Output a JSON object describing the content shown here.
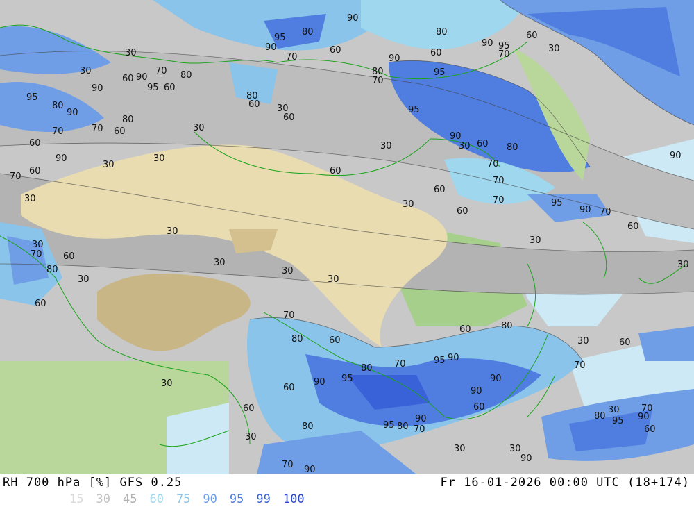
{
  "footer": {
    "title": "RH 700 hPa [%] GFS 0.25",
    "timestamp": "Fr 16-01-2026 00:00 UTC (18+174)"
  },
  "legend": [
    {
      "label": "15",
      "color": "#d9d9d9"
    },
    {
      "label": "30",
      "color": "#c3c3c3"
    },
    {
      "label": "45",
      "color": "#b0b0b0"
    },
    {
      "label": "60",
      "color": "#9fd7ee"
    },
    {
      "label": "75",
      "color": "#8ac4ea"
    },
    {
      "label": "90",
      "color": "#6f9ee6"
    },
    {
      "label": "95",
      "color": "#4f7ee0"
    },
    {
      "label": "99",
      "color": "#3a62d8"
    },
    {
      "label": "100",
      "color": "#2d46d0"
    }
  ],
  "contour_labels": [
    "90",
    "80",
    "95",
    "90",
    "80",
    "60",
    "70",
    "60",
    "90",
    "80",
    "95",
    "70",
    "90",
    "95",
    "70",
    "60",
    "30",
    "30",
    "30",
    "60",
    "90",
    "70",
    "80",
    "95",
    "60",
    "80",
    "60",
    "90",
    "95",
    "80",
    "90",
    "80",
    "70",
    "60",
    "30",
    "70",
    "60",
    "60",
    "30",
    "95",
    "90",
    "30",
    "30",
    "90",
    "30",
    "60",
    "80",
    "70",
    "60",
    "70",
    "60",
    "70",
    "60",
    "30",
    "95",
    "90",
    "70",
    "60",
    "30",
    "30",
    "30",
    "70",
    "60",
    "30",
    "30",
    "30",
    "90",
    "30",
    "60",
    "30",
    "30",
    "70",
    "80",
    "60",
    "80",
    "70",
    "95",
    "90",
    "80",
    "70",
    "30",
    "60",
    "90",
    "95",
    "90",
    "95",
    "60",
    "60",
    "90",
    "30",
    "60",
    "60",
    "80",
    "95",
    "80",
    "90",
    "70",
    "80",
    "30",
    "70",
    "60",
    "30",
    "30",
    "90",
    "70",
    "90",
    "30",
    "80",
    "30",
    "70",
    "90",
    "60"
  ]
}
